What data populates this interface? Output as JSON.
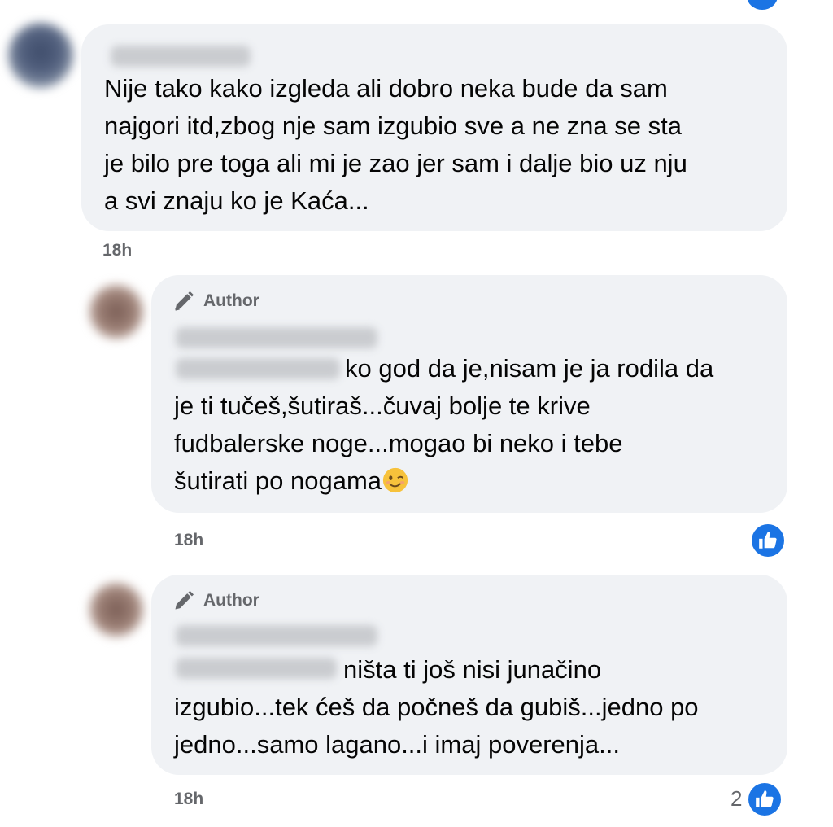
{
  "comment_main": {
    "text": "Nije tako kako izgleda ali dobro neka bude da sam\nnajgori itd,zbog nje sam izgubio sve a ne zna se sta\nje bilo pre toga ali mi je zao jer sam i dalje bio uz nju\na svi znaju ko je Kaća...",
    "time": "18h"
  },
  "reply_1": {
    "badge": "Author",
    "text_first": "ko god da je,nisam je ja rodila da",
    "text_rest": "je ti tučeš,šutiraš...čuvaj bolje te krive\nfudbalerske noge...mogao bi neko i tebe\nšutirati po nogama",
    "time": "18h"
  },
  "reply_2": {
    "badge": "Author",
    "text_first": "ništa ti još nisi junačino",
    "text_rest": "izgubio...tek ćeš da počneš da gubiš...jedno po\njedno...samo lagano...i imaj poverenja...",
    "time": "18h",
    "reaction_count": "2"
  },
  "colors": {
    "bubble": "#f0f2f5",
    "meta_text": "#65676b",
    "like_blue": "#1b74e4"
  },
  "icons": {
    "author_badge": "pen-icon",
    "reaction": "thumbs-up-icon",
    "emoji": "winking-face-emoji"
  }
}
